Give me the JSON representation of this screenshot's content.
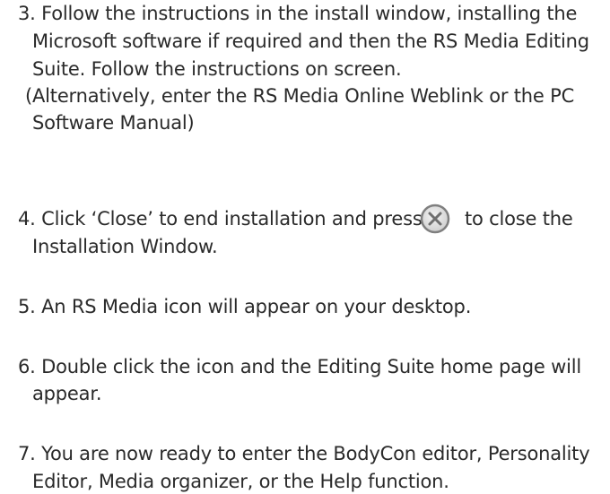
{
  "steps": [
    {
      "lines": [
        "3.  Follow the instructions in the install window, installing the",
        "Microsoft software if required and then the RS Media Editing",
        "Suite. Follow the instructions on screen.",
        "(Alternatively, enter the RS Media Online Weblink or the PC",
        "Software Manual)"
      ]
    },
    {
      "lines": [
        "4.  Click ‘Close’ to end installation and press",
        "to close the",
        "Installation Window."
      ],
      "icon": "close-circle-x-icon"
    },
    {
      "lines": [
        "5.  An RS Media icon will appear on your desktop."
      ]
    },
    {
      "lines": [
        "6.  Double click the icon and the Editing Suite home page will",
        "appear."
      ]
    },
    {
      "lines": [
        "7.  You are now ready to enter the BodyCon editor, Personality",
        "Editor, Media organizer, or the Help function."
      ]
    }
  ],
  "colors": {
    "text": "#2a2a2a",
    "icon_ring": "#8a8a8a",
    "icon_fill": "#e6e6e6"
  }
}
